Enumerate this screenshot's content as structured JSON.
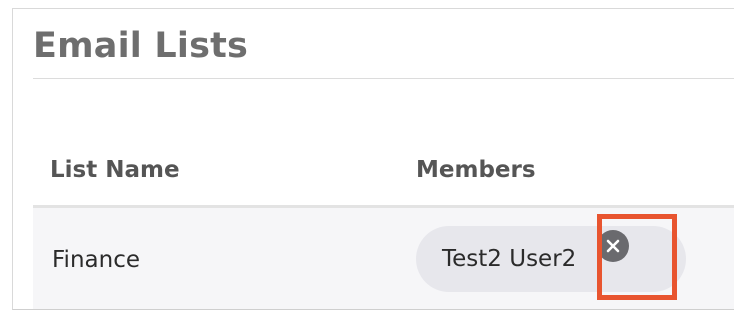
{
  "page": {
    "title": "Email Lists"
  },
  "table": {
    "columns": [
      {
        "label": "List Name"
      },
      {
        "label": "Members"
      }
    ],
    "rows": [
      {
        "list_name": "Finance",
        "members": [
          {
            "label": "Test2 User2",
            "remove_icon": "close-circle-icon"
          }
        ]
      }
    ]
  },
  "annotation": {
    "highlight_color": "#e8542f"
  }
}
